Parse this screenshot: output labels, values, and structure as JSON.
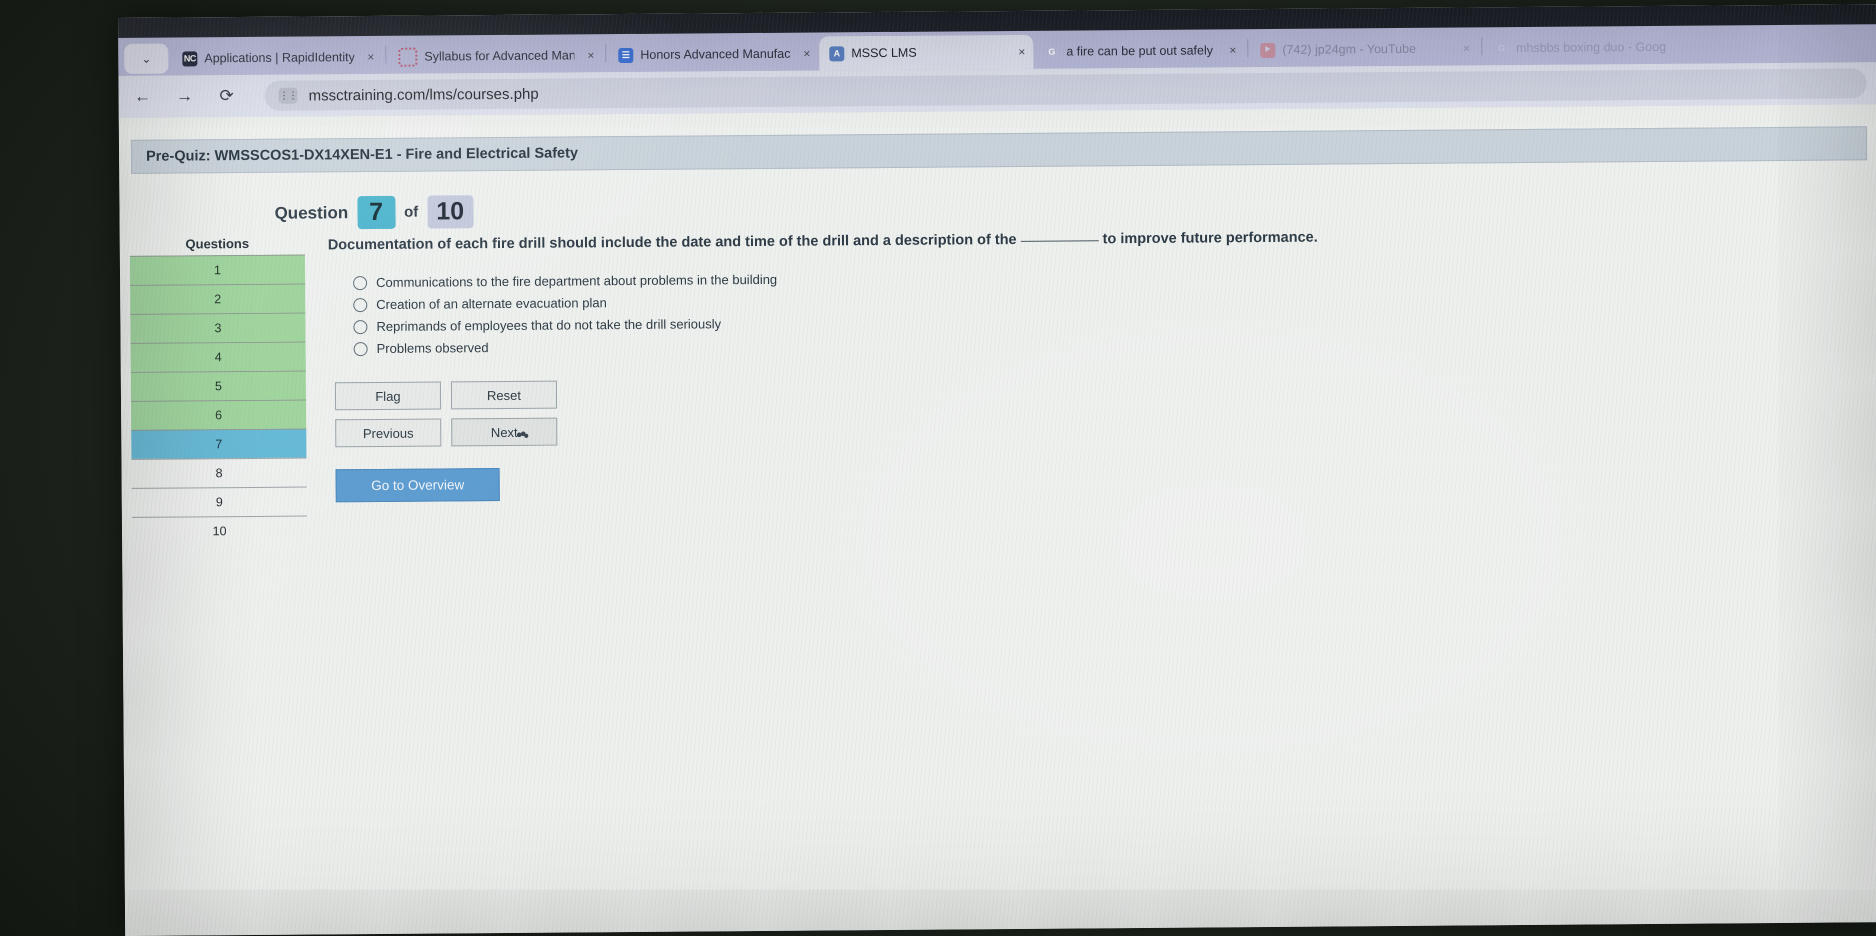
{
  "browser": {
    "tabs": [
      {
        "title": "Applications | RapidIdentity",
        "favicon": "rapididentity-icon",
        "active": false
      },
      {
        "title": "Syllabus for Advanced Manufa",
        "favicon": "loading-spinner-icon",
        "active": false
      },
      {
        "title": "Honors Advanced Manufactur",
        "favicon": "document-icon",
        "active": false
      },
      {
        "title": "MSSC LMS",
        "favicon": "mssc-icon",
        "active": true
      },
      {
        "title": "a fire can be put out safely usi",
        "favicon": "google-icon",
        "active": false
      },
      {
        "title": "(742) jp24gm - YouTube",
        "favicon": "youtube-icon",
        "active": false
      },
      {
        "title": "mhsbbs boxing duo - Goog",
        "favicon": "google-icon",
        "active": false
      }
    ],
    "close_label": "×",
    "tab_list_chevron": "⌄",
    "nav": {
      "back": "←",
      "forward": "→",
      "reload": "⟳",
      "site_settings_icon": "tune-icon"
    },
    "url": "mssctraining.com/lms/courses.php"
  },
  "quiz": {
    "header_title": "Pre-Quiz: WMSSCOS1-DX14XEN-E1 - Fire and Electrical Safety",
    "question_word": "Question",
    "current_number": "7",
    "of_word": "of",
    "total_number": "10",
    "sidebar_title": "Questions",
    "questions": [
      {
        "number": "1",
        "state": "answered"
      },
      {
        "number": "2",
        "state": "answered"
      },
      {
        "number": "3",
        "state": "answered"
      },
      {
        "number": "4",
        "state": "answered"
      },
      {
        "number": "5",
        "state": "answered"
      },
      {
        "number": "6",
        "state": "answered"
      },
      {
        "number": "7",
        "state": "current"
      },
      {
        "number": "8",
        "state": "unvisited"
      },
      {
        "number": "9",
        "state": "unvisited"
      },
      {
        "number": "10",
        "state": "unvisited"
      }
    ],
    "question_text_before": "Documentation of each fire drill should include the date and time of the drill and a description of the",
    "question_text_after": "to improve future performance.",
    "options": [
      "Communications to the fire department about problems in the building",
      "Creation of an alternate evacuation plan",
      "Reprimands of employees that do not take the drill seriously",
      "Problems observed"
    ],
    "buttons": {
      "flag": "Flag",
      "reset": "Reset",
      "previous": "Previous",
      "next": "Next",
      "overview": "Go to Overview"
    }
  },
  "colors": {
    "current_question": "#63b8d6",
    "answered_question": "#9ed49b",
    "badge_number": "#4bb4cd",
    "overview_button": "#5b9bd0"
  }
}
